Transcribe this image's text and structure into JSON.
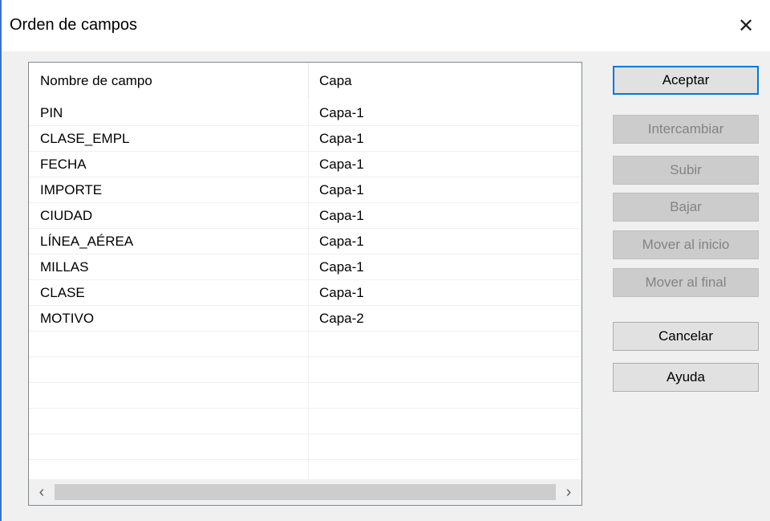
{
  "window": {
    "title": "Orden de campos",
    "close_glyph": "✕"
  },
  "list": {
    "columns": [
      "Nombre de campo",
      "Capa"
    ],
    "rows": [
      [
        "PIN",
        "Capa-1"
      ],
      [
        "CLASE_EMPL",
        "Capa-1"
      ],
      [
        "FECHA",
        "Capa-1"
      ],
      [
        "IMPORTE",
        "Capa-1"
      ],
      [
        "CIUDAD",
        "Capa-1"
      ],
      [
        "LÍNEA_AÉREA",
        "Capa-1"
      ],
      [
        "MILLAS",
        "Capa-1"
      ],
      [
        "CLASE",
        "Capa-1"
      ],
      [
        "MOTIVO",
        "Capa-2"
      ],
      [
        "",
        ""
      ],
      [
        "",
        ""
      ],
      [
        "",
        ""
      ],
      [
        "",
        ""
      ],
      [
        "",
        ""
      ],
      [
        "",
        ""
      ]
    ],
    "scroll_left_glyph": "‹",
    "scroll_right_glyph": "›"
  },
  "buttons": {
    "accept": "Aceptar",
    "swap": "Intercambiar",
    "up": "Subir",
    "down": "Bajar",
    "move_top": "Mover al inicio",
    "move_bottom": "Mover al final",
    "cancel": "Cancelar",
    "help": "Ayuda"
  },
  "colors": {
    "accent": "#0078d7",
    "window_border": "#3a72c9",
    "disabled_button": "#cccccc",
    "button_face": "#e1e1e1"
  },
  "icons": {
    "close": "close-icon",
    "scroll_left": "chevron-left-icon",
    "scroll_right": "chevron-right-icon"
  }
}
